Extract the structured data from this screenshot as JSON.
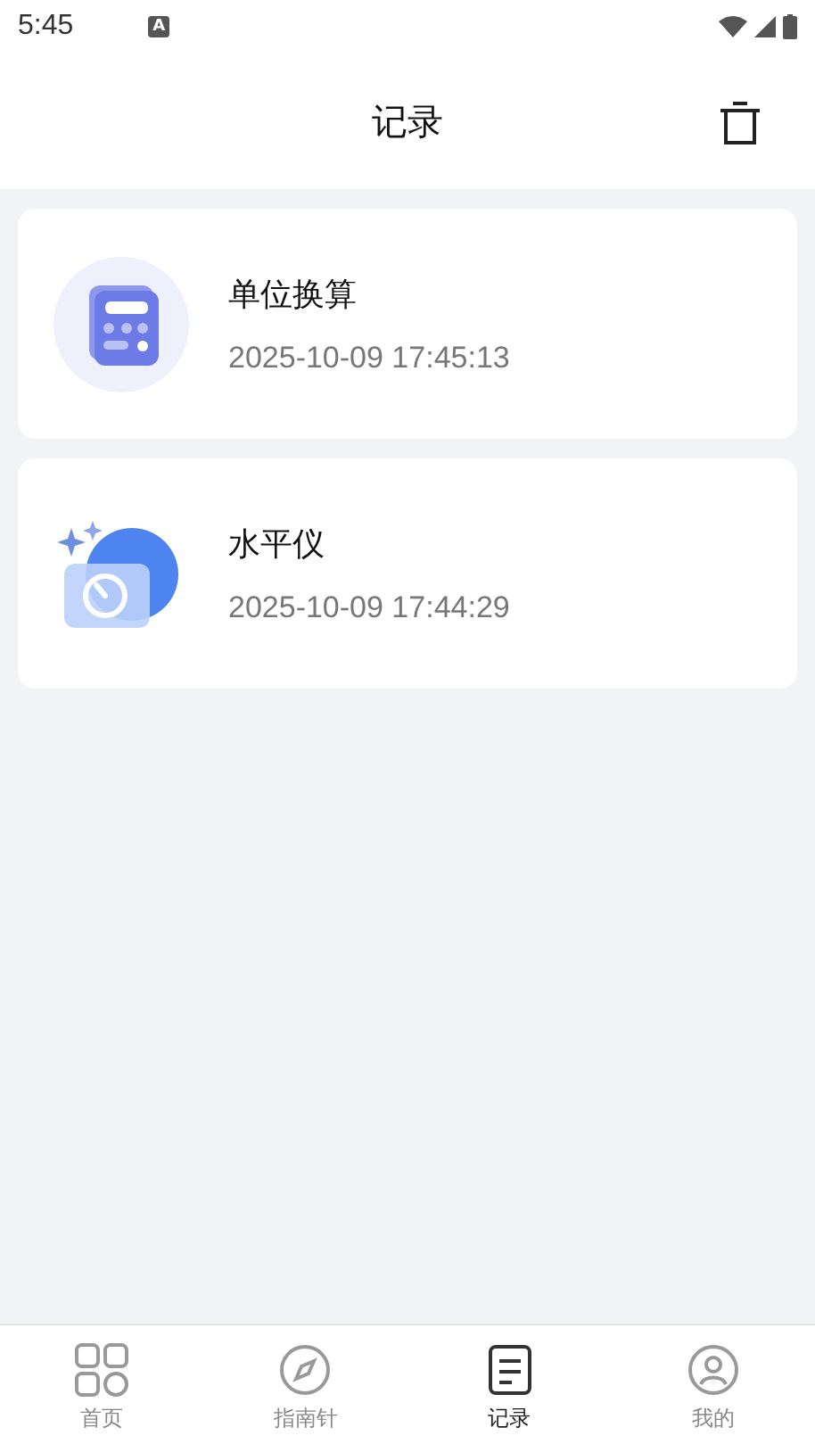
{
  "status_bar": {
    "time": "5:45",
    "notification": "A"
  },
  "header": {
    "title": "记录"
  },
  "records": [
    {
      "kind": "calculator",
      "name": "单位换算",
      "time": "2025-10-09 17:45:13"
    },
    {
      "kind": "level",
      "name": "水平仪",
      "time": "2025-10-09 17:44:29"
    }
  ],
  "tabs": [
    {
      "kind": "home",
      "label": "首页",
      "selected": false
    },
    {
      "kind": "compass",
      "label": "指南针",
      "selected": false
    },
    {
      "kind": "records",
      "label": "记录",
      "selected": true
    },
    {
      "kind": "profile",
      "label": "我的",
      "selected": false
    }
  ]
}
